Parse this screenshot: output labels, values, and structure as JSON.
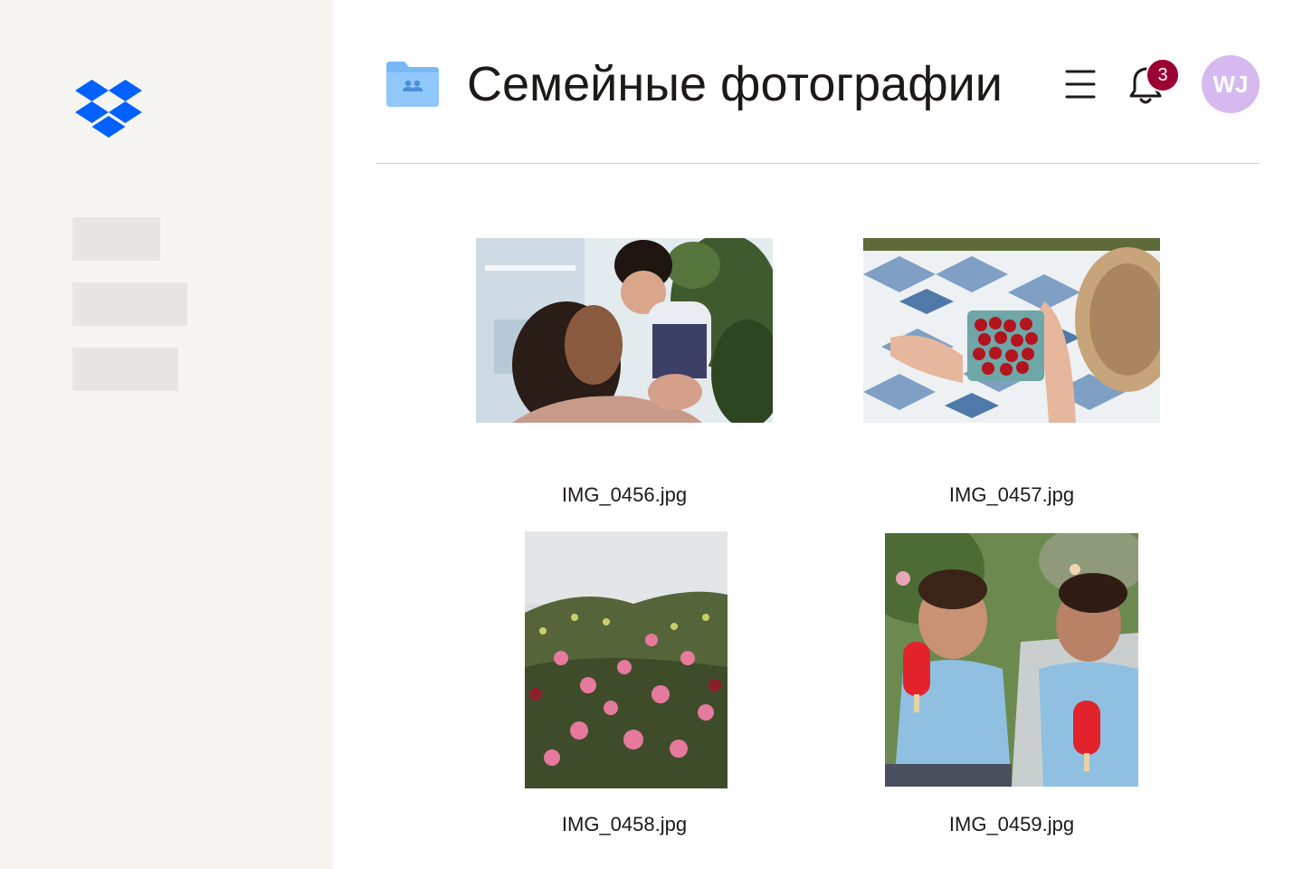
{
  "app": {
    "logo_icon": "dropbox-logo-icon",
    "brand_color": "#0061fe"
  },
  "header": {
    "folder_icon": "shared-folder-icon",
    "title": "Семейные фотографии",
    "menu_icon": "hamburger-menu-icon",
    "notifications": {
      "icon": "bell-icon",
      "count": "3",
      "badge_color": "#9b0032"
    },
    "avatar": {
      "initials": "WJ",
      "color": "#d6b9ef"
    }
  },
  "files": [
    {
      "name": "IMG_0456.jpg",
      "subject": "woman kissing baby"
    },
    {
      "name": "IMG_0457.jpg",
      "subject": "cherries on quilt"
    },
    {
      "name": "IMG_0458.jpg",
      "subject": "pink flowers"
    },
    {
      "name": "IMG_0459.jpg",
      "subject": "boys with popsicles"
    }
  ]
}
